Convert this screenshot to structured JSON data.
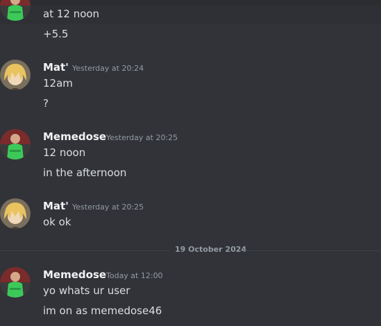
{
  "messages": {
    "m1": {
      "lines": [
        "at 12 noon",
        "+5.5"
      ]
    },
    "m2": {
      "author": "Mat'",
      "timestamp": "Yesterday at 20:24",
      "lines": [
        "12am",
        "?"
      ]
    },
    "m3": {
      "author": "Memedose",
      "timestamp": "Yesterday at 20:25",
      "lines": [
        "12 noon",
        "in the afternoon"
      ]
    },
    "m4": {
      "author": "Mat'",
      "timestamp": "Yesterday at 20:25",
      "lines": [
        "ok ok"
      ]
    },
    "m5": {
      "author": "Memedose",
      "timestamp": "Today at 12:00",
      "lines": [
        "yo whats ur user",
        "im on as memedose46"
      ]
    }
  },
  "date_divider": "19 October 2024",
  "colors": {
    "background": "#313338",
    "author_memedose": "#f2f3f5",
    "author_mat": "#f2f3f5",
    "timestamp": "#949ba4"
  },
  "icons": {
    "avatar_memedose": "goalkeeper-avatar-icon",
    "avatar_mat": "anime-blonde-avatar-icon"
  }
}
